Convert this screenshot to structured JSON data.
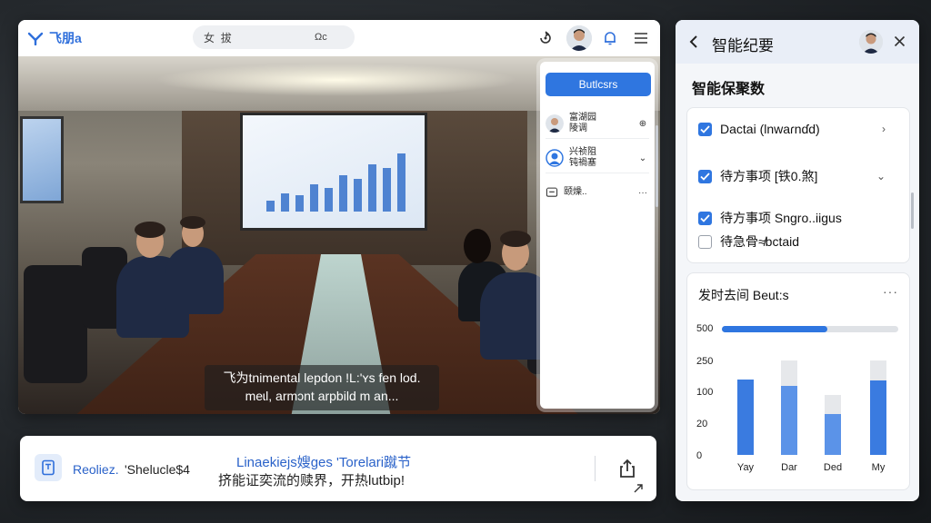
{
  "app": {
    "name": "飞朋a"
  },
  "search": {
    "value": "女  拔",
    "icon_text": "Ωc"
  },
  "participants_panel": {
    "button_label": "Butlcsrs",
    "rows": [
      {
        "name": "富湖园\n陵调",
        "control": "⊕"
      },
      {
        "name": "兴祯阻\n钝禍塞",
        "control": "⌄"
      },
      {
        "name": "颐燥..",
        "control": "···"
      }
    ]
  },
  "caption": {
    "text": "飞为tnimental lepdon !L:'ʏs fen lod. meɩl, armɔnt arpbild m an..."
  },
  "bottom_bar": {
    "link1": "Reoliez.",
    "link2": "'Shelucle$4",
    "title": "Linaekiejs嫂ges 'Torelari蹴节",
    "subtitle": "挤能证奕流的赎界，开热lutbip!"
  },
  "summary_panel": {
    "title": "智能纪要",
    "section_title": "智能保聚数",
    "todos": [
      {
        "label": "Dactai (lnwaɾnɗd)",
        "checked": true,
        "chevron": "›"
      },
      {
        "label": "待方事项 [铁0.煞]",
        "checked": true,
        "chevron": "⌄"
      },
      {
        "label": "待方事项 Sngro..iigus",
        "checked": true,
        "chevron": ""
      },
      {
        "label": "待急骨≉bctaid",
        "checked": false,
        "chevron": ""
      }
    ],
    "chart_card": {
      "title": "发时去间 Beut:s",
      "more": "···"
    }
  },
  "colors": {
    "accent": "#2f76e0",
    "link": "#2a62c9"
  },
  "chart_data": {
    "type": "bar",
    "title": "发时去间 Beut:s",
    "progress_fraction": 0.6,
    "categories": [
      "Yay",
      "Dar",
      "Ded",
      "My"
    ],
    "values": [
      120,
      110,
      65,
      118
    ],
    "maxima": [
      120,
      150,
      95,
      150
    ],
    "y_ticks": [
      "500",
      "250",
      "100",
      "20",
      "0"
    ],
    "ylim": [
      0,
      150
    ]
  }
}
